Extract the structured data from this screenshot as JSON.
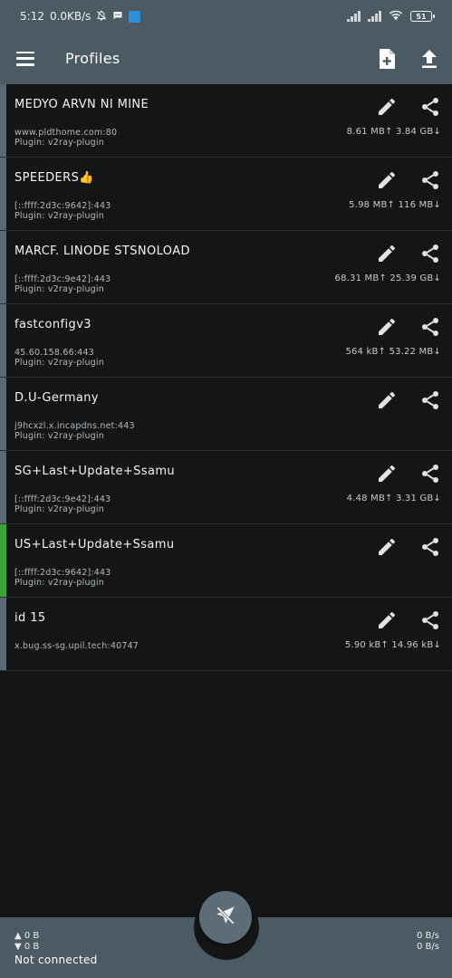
{
  "status_bar": {
    "time": "5:12",
    "speed": "0.0KB/s",
    "battery": "51",
    "icons": [
      "bell-off-icon",
      "chat-icon",
      "app-icon",
      "signal-icon",
      "signal-icon",
      "wifi-icon",
      "battery-icon"
    ]
  },
  "app_bar": {
    "title": "Profiles",
    "icons": [
      "menu-icon",
      "add-file-icon",
      "upload-icon"
    ]
  },
  "profiles": [
    {
      "name": "MEDYO ARVN NI MINE",
      "address": "www.pldthome.com:80",
      "plugin": "Plugin: v2ray-plugin",
      "traffic": "8.61 MB↑  3.84 GB↓",
      "active": false
    },
    {
      "name": "SPEEDERS👍",
      "address": "[::ffff:2d3c:9642]:443",
      "plugin": "Plugin: v2ray-plugin",
      "traffic": "5.98 MB↑  116 MB↓",
      "active": false
    },
    {
      "name": "MARCF. LINODE STSNOLOAD",
      "address": "[::ffff:2d3c:9e42]:443",
      "plugin": "Plugin: v2ray-plugin",
      "traffic": "68.31 MB↑  25.39 GB↓",
      "active": false
    },
    {
      "name": "fastconfigv3",
      "address": "45.60.158.66:443",
      "plugin": "Plugin: v2ray-plugin",
      "traffic": "564 kB↑  53.22 MB↓",
      "active": false
    },
    {
      "name": "D.U-Germany",
      "address": "j9hcxzl.x.incapdns.net:443",
      "plugin": "Plugin: v2ray-plugin",
      "traffic": "",
      "active": false
    },
    {
      "name": "SG+Last+Update+Ssamu",
      "address": "[::ffff:2d3c:9e42]:443",
      "plugin": "Plugin: v2ray-plugin",
      "traffic": "4.48 MB↑  3.31 GB↓",
      "active": false
    },
    {
      "name": "US+Last+Update+Ssamu",
      "address": "[::ffff:2d3c:9642]:443",
      "plugin": "Plugin: v2ray-plugin",
      "traffic": "",
      "active": true
    },
    {
      "name": "id 15",
      "address": "x.bug.ss-sg.upil.tech:40747",
      "plugin": "",
      "traffic": "5.90 kB↑  14.96 kB↓",
      "active": false
    }
  ],
  "bottom_bar": {
    "upload": "▲ 0 B",
    "download": "▼ 0 B",
    "up_rate": "0 B/s",
    "down_rate": "0 B/s",
    "status": "Not connected",
    "fab_icon": "plane-off-icon"
  },
  "colors": {
    "bar": "#4c5a63",
    "background": "#141516",
    "active_accent": "#3fa33c",
    "inactive_accent": "#5a6a74"
  }
}
